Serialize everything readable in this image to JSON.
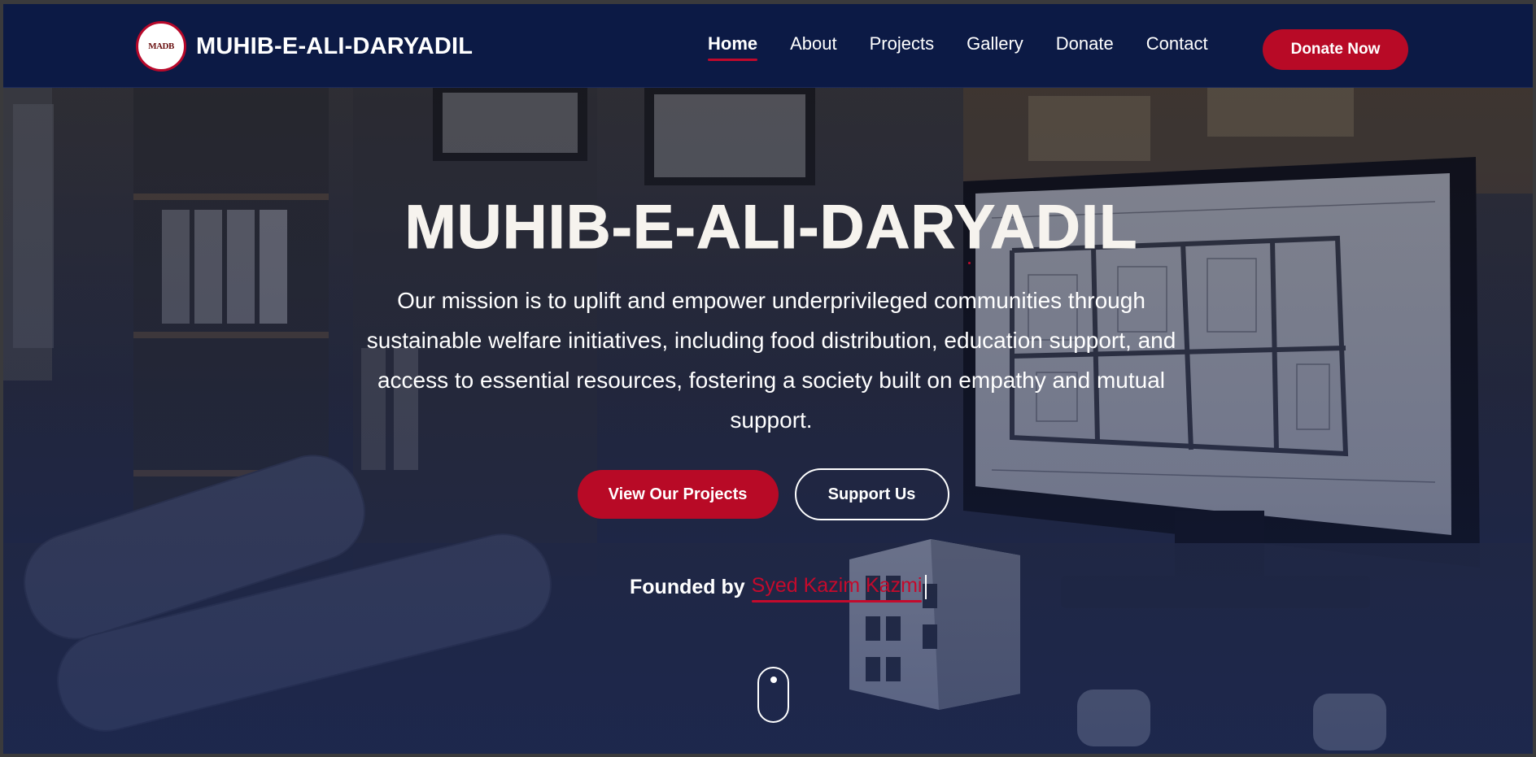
{
  "brand": {
    "name": "MUHIB-E-ALI-DARYADIL",
    "logo_text": "MADB"
  },
  "nav": {
    "items": [
      {
        "label": "Home",
        "active": true
      },
      {
        "label": "About",
        "active": false
      },
      {
        "label": "Projects",
        "active": false
      },
      {
        "label": "Gallery",
        "active": false
      },
      {
        "label": "Donate",
        "active": false
      },
      {
        "label": "Contact",
        "active": false
      }
    ],
    "cta_label": "Donate Now"
  },
  "hero": {
    "title": "MUHIB-E-ALI-DARYADIL",
    "mission": "Our mission is to uplift and empower underprivileged communities through sustainable welfare initiatives, including food distribution, education support, and access to essential resources, fostering a society built on empathy and mutual support.",
    "primary_button": "View Our Projects",
    "secondary_button": "Support Us",
    "founded_label": "Founded by",
    "founder_name": "Syed Kazim Kazmi"
  },
  "colors": {
    "navbar_bg": "#0c1a45",
    "accent_red": "#b80a26",
    "text_white": "#ffffff"
  },
  "icons": {
    "scroll": "mouse-scroll-icon",
    "logo": "organization-logo-icon"
  }
}
